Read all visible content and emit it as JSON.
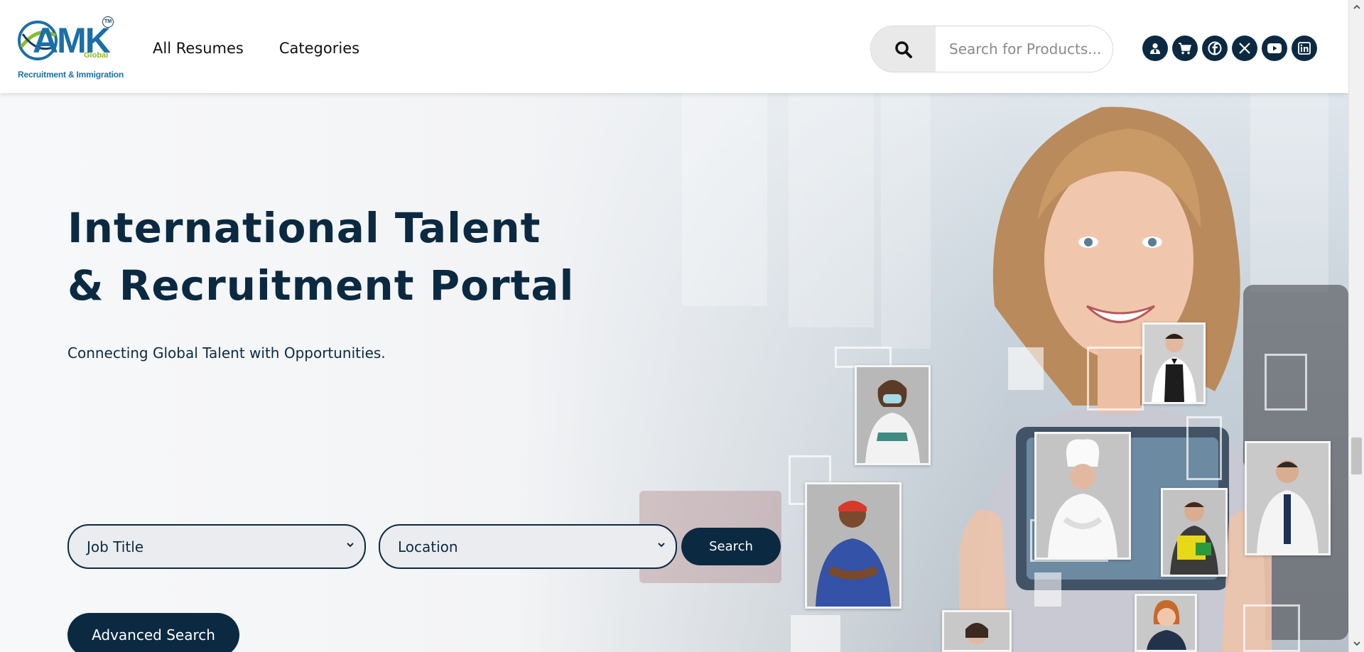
{
  "header": {
    "logo": {
      "brand": "AMK",
      "global": "Global",
      "tm": "TM",
      "tagline": "Recruitment & Immigration"
    },
    "nav": [
      {
        "label": "All Resumes"
      },
      {
        "label": "Categories"
      }
    ],
    "search": {
      "placeholder": "Search for Products...",
      "icon": "search-icon"
    },
    "social_icons": [
      "account-icon",
      "cart-icon",
      "facebook-icon",
      "x-icon",
      "youtube-icon",
      "linkedin-icon"
    ]
  },
  "hero": {
    "title_line1": "International Talent",
    "title_line2": "& Recruitment Portal",
    "subtitle": "Connecting Global Talent with Opportunities.",
    "job_title_select": "Job Title",
    "location_select": "Location",
    "search_button": "Search",
    "advanced_search_button": "Advanced Search"
  },
  "colors": {
    "primary": "#0b2a42",
    "brand_blue": "#1b6fa8",
    "brand_green": "#8dbb2a"
  }
}
